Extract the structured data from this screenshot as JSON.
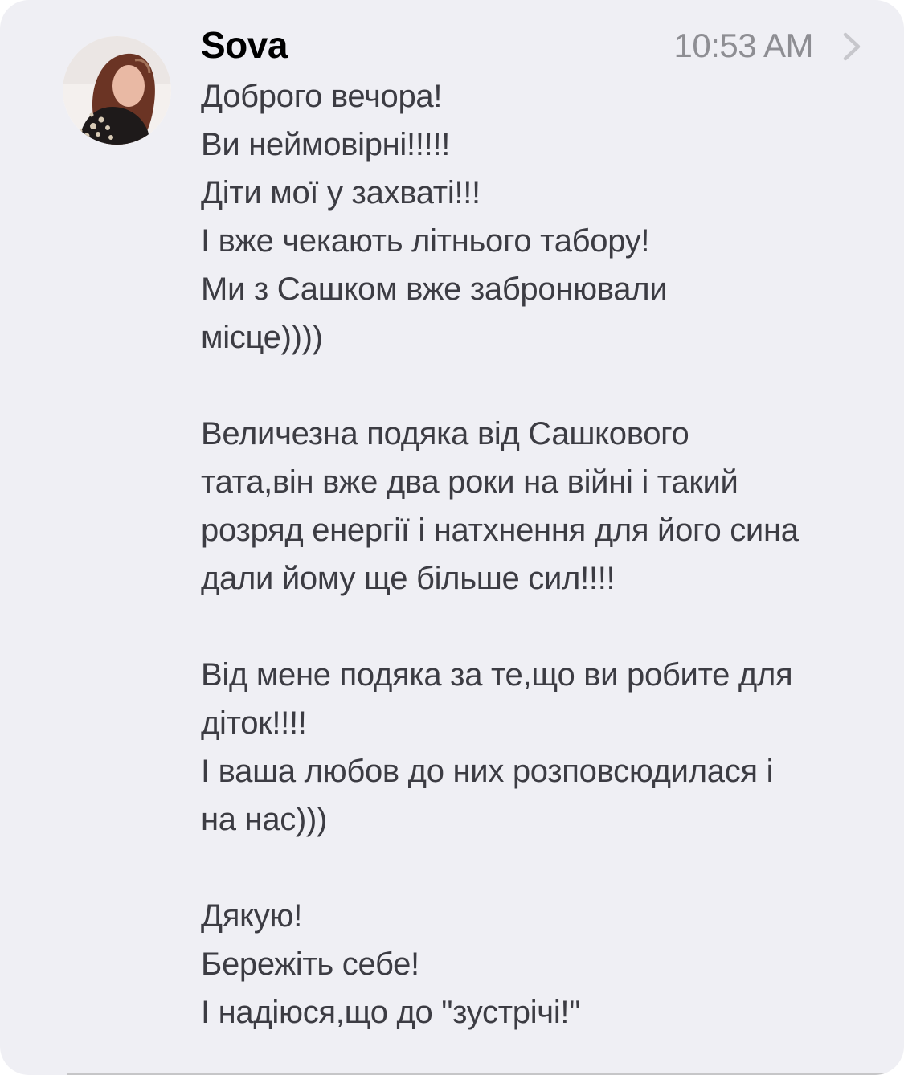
{
  "message": {
    "sender": "Sova",
    "time": "10:53 AM",
    "lines": [
      "Доброго вечора!",
      "Ви неймовірні!!!!!",
      "Діти мої у захваті!!!",
      "І вже чекають літнього табору!",
      "Ми з Сашком вже забронювали",
      "місце))))",
      "",
      "Величезна подяка від Сашкового",
      "тата,він вже два роки на війні і такий",
      "розряд енергії і натхнення для його сина",
      "дали йому ще більше сил!!!!",
      "",
      "Від мене подяка за те,що ви робите для",
      "діток!!!!",
      "І ваша любов до них розповсюдилася і",
      "на нас)))",
      "",
      "Дякую!",
      "Бережіть себе!",
      "І надіюся,що до \"зустрічі!\""
    ]
  },
  "icons": {
    "avatar": "avatar-photo",
    "chevron": "chevron-right-icon"
  },
  "colors": {
    "background": "#efeff4",
    "sender": "#000000",
    "body_text": "#3c3c43",
    "time": "#8e8e93"
  }
}
